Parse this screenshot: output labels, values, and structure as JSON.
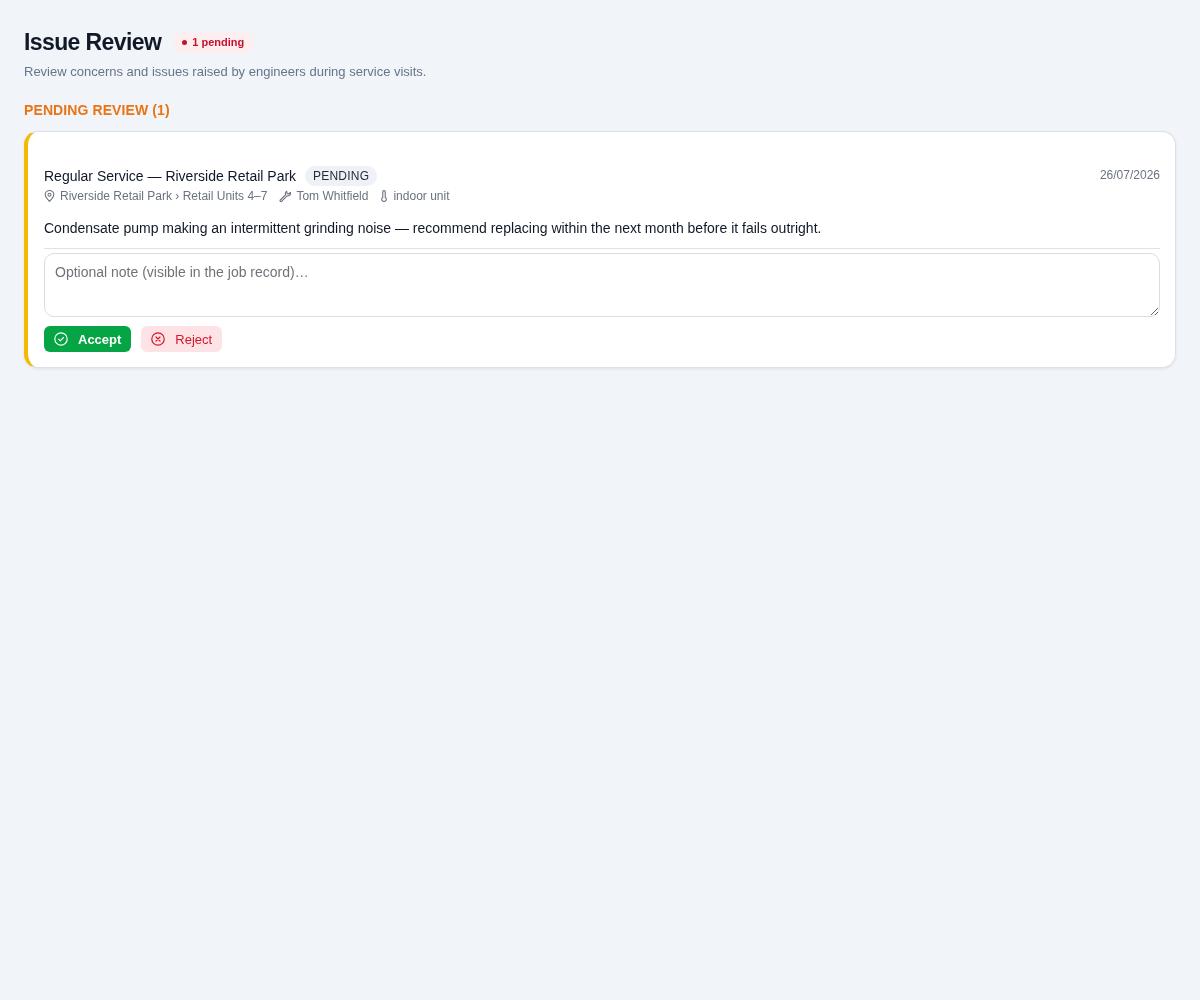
{
  "header": {
    "title": "Issue Review",
    "badge": "1 pending",
    "subtitle": "Review concerns and issues raised by engineers during service visits."
  },
  "sections": [
    {
      "heading": "PENDING REVIEW (1)",
      "issues": [
        {
          "kind": "pending",
          "title": "Regular Service — Riverside Retail Park",
          "status_label": "PENDING",
          "date": "26/07/2026",
          "meta": [
            {
              "kind": "location",
              "text": "Riverside Retail Park › Retail Units 4–7"
            },
            {
              "kind": "engineer",
              "text": "Tom Whitfield"
            },
            {
              "kind": "equipment",
              "text": "indoor unit"
            }
          ],
          "description": "Condensate pump making an intermittent grinding noise — recommend replacing within the next month before it fails outright.",
          "note": {
            "placeholder": "Optional note (visible in the job record)…"
          },
          "actions": [
            {
              "kind": "accept",
              "label": "Accept"
            },
            {
              "kind": "reject",
              "label": "Reject"
            }
          ]
        }
      ]
    }
  ]
}
